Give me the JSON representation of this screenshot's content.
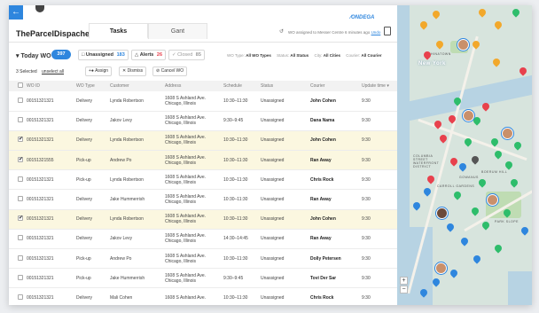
{
  "app": {
    "title": "TheParcelDispacher™",
    "logo": "⁄ONDEGA",
    "back_icon": "arrow-left-icon"
  },
  "tabs": [
    {
      "label": "Tasks",
      "active": true
    },
    {
      "label": "Gant",
      "active": false
    }
  ],
  "notice": {
    "text": "WO assigned to Messer Centre 6 minutes ago",
    "link": "Undo"
  },
  "toolbar": {
    "today_label": "Today WO",
    "today_count": "397",
    "unassigned_label": "Unassigned",
    "unassigned_count": "183",
    "alerts_label": "Alerts",
    "alerts_count": "26",
    "closed_label": "Closed",
    "closed_count": "85"
  },
  "filters": {
    "wo_type_label": "WO Type:",
    "wo_type_value": "All WO Types",
    "status_label": "Status:",
    "status_value": "All Status",
    "city_label": "City:",
    "city_value": "All Cities",
    "courier_label": "Courier:",
    "courier_value": "All Courier"
  },
  "actions": {
    "selected_text": "3 Selected",
    "unselect_label": "unselect all",
    "assign_label": "Assign",
    "dismiss_label": "Dismiss",
    "cancel_label": "Cancel WO"
  },
  "table": {
    "headers": [
      "WO ID",
      "WO Type",
      "Customer",
      "Address",
      "Schedule",
      "Status",
      "Courier",
      "Update time"
    ],
    "rows": [
      {
        "checked": false,
        "id": "00151321321",
        "type": "Delivery",
        "customer": "Lynda Robertson",
        "addr1": "1608 S Ashland Ave.",
        "addr2": "Chicago, Illinois",
        "schedule": "10:30–11:30",
        "status": "Unassigned",
        "courier": "John Cohen",
        "time": "9:30"
      },
      {
        "checked": false,
        "id": "00151321321",
        "type": "Delivery",
        "customer": "Jakov Levy",
        "addr1": "1608 S Ashland Ave.",
        "addr2": "Chicago, Illinois",
        "schedule": "9:30–9:45",
        "status": "Unassigned",
        "courier": "Dana Nama",
        "time": "9:30"
      },
      {
        "checked": true,
        "id": "00151321321",
        "type": "Delivery",
        "customer": "Lynda Robertson",
        "addr1": "1608 S Ashland Ave.",
        "addr2": "Chicago, Illinois",
        "schedule": "10:30–11:30",
        "status": "Unassigned",
        "courier": "John Cohen",
        "time": "9:30"
      },
      {
        "checked": true,
        "id": "00151321555",
        "type": "Pick-up",
        "customer": "Andrew Po",
        "addr1": "1608 S Ashland Ave.",
        "addr2": "Chicago, Illinois",
        "schedule": "10:30–11:30",
        "status": "Unassigned",
        "courier": "Ran Away",
        "time": "9:30"
      },
      {
        "checked": false,
        "id": "00151321321",
        "type": "Pick-up",
        "customer": "Lynda Robertson",
        "addr1": "1608 S Ashland Ave.",
        "addr2": "Chicago, Illinois",
        "schedule": "10:30–11:30",
        "status": "Unassigned",
        "courier": "Chris Rock",
        "time": "9:30"
      },
      {
        "checked": false,
        "id": "00151321321",
        "type": "Delivery",
        "customer": "Jake Hummerrish",
        "addr1": "1608 S Ashland Ave.",
        "addr2": "Chicago, Illinois",
        "schedule": "10:30–11:30",
        "status": "Unassigned",
        "courier": "Ran Away",
        "time": "9:30"
      },
      {
        "checked": true,
        "id": "00151321321",
        "type": "Delivery",
        "customer": "Lynda Robertson",
        "addr1": "1608 S Ashland Ave.",
        "addr2": "Chicago, Illinois",
        "schedule": "10:30–11:30",
        "status": "Unassigned",
        "courier": "John Cohen",
        "time": "9:30"
      },
      {
        "checked": false,
        "id": "00151321321",
        "type": "Delivery",
        "customer": "Jakov Levy",
        "addr1": "1608 S Ashland Ave.",
        "addr2": "Chicago, Illinois",
        "schedule": "14:30–14:45",
        "status": "Unassigned",
        "courier": "Ran Away",
        "time": "9:30"
      },
      {
        "checked": false,
        "id": "00151321321",
        "type": "Pick-up",
        "customer": "Andrew Po",
        "addr1": "1608 S Ashland Ave.",
        "addr2": "Chicago, Illinois",
        "schedule": "10:30–11:30",
        "status": "Unassigned",
        "courier": "Dolly Petersen",
        "time": "9:30"
      },
      {
        "checked": false,
        "id": "00151321321",
        "type": "Pick-up",
        "customer": "Jake Hummerrish",
        "addr1": "1608 S Ashland Ave.",
        "addr2": "Chicago, Illinois",
        "schedule": "9:30–9:45",
        "status": "Unassigned",
        "courier": "Tovi Der Sar",
        "time": "9:30"
      },
      {
        "checked": false,
        "id": "00151321321",
        "type": "Delivery",
        "customer": "Mali Cohen",
        "addr1": "1608 S Ashland Ave.",
        "addr2": "",
        "schedule": "10:30–11:30",
        "status": "Unassigned",
        "courier": "Chris Rock",
        "time": "9:30"
      }
    ]
  },
  "map": {
    "labels": [
      "New York",
      "CHINATOWN",
      "GOWANUS",
      "CARROLL GARDENS",
      "PARK SLOPE",
      "COLUMBIA STREET WATERFRONT DISTRICT",
      "BOERUM HILL"
    ],
    "pin_colors": [
      "#f2a82b",
      "#e8414d",
      "#2ebd6b",
      "#2e86de",
      "#555555"
    ],
    "zoom_in": "+",
    "zoom_out": "−"
  },
  "colors": {
    "accent": "#2e86de",
    "selected_row": "#fbf7e0",
    "alert": "#e8414d",
    "closed": "#2ebd6b"
  }
}
